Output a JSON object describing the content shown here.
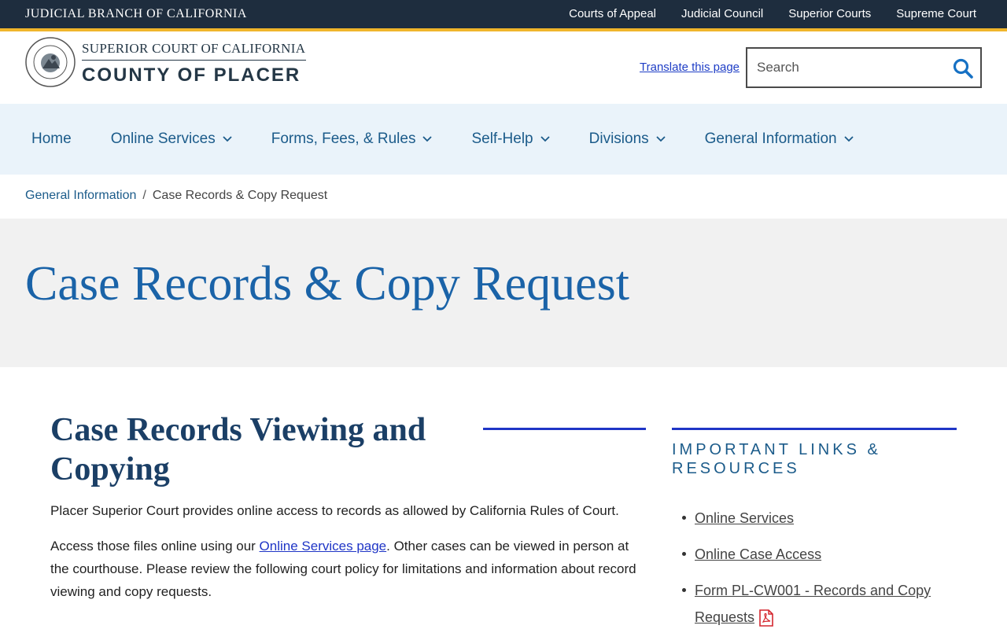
{
  "topbar": {
    "brand": "JUDICIAL BRANCH OF CALIFORNIA",
    "links": [
      "Courts of Appeal",
      "Judicial Council",
      "Superior Courts",
      "Supreme Court"
    ]
  },
  "header": {
    "logo_top": "SUPERIOR COURT OF CALIFORNIA",
    "logo_bottom": "COUNTY OF PLACER",
    "translate": "Translate this page",
    "search_placeholder": "Search"
  },
  "nav": {
    "items": [
      {
        "label": "Home"
      },
      {
        "label": "Online Services"
      },
      {
        "label": "Forms, Fees, & Rules"
      },
      {
        "label": "Self-Help"
      },
      {
        "label": "Divisions"
      },
      {
        "label": "General Information"
      }
    ]
  },
  "breadcrumb": {
    "parent": "General Information",
    "separator": "/",
    "current": "Case Records & Copy Request"
  },
  "hero": {
    "title": "Case Records & Copy Request"
  },
  "main": {
    "heading": "Case Records Viewing and Copying",
    "para1": "Placer Superior Court provides online access to records as allowed by California Rules of Court.",
    "para2_before": "Access those files online using our ",
    "para2_link": "Online Services page",
    "para2_after": ". Other cases can be viewed in person at the courthouse. Please review the following court policy for limitations and information about record viewing and copy requests."
  },
  "sidebar": {
    "title": "IMPORTANT LINKS & RESOURCES",
    "links": [
      {
        "label": "Online Services"
      },
      {
        "label": "Online Case Access"
      },
      {
        "label": "Form PL-CW001 - Records and Copy Requests"
      }
    ]
  },
  "colors": {
    "topbar": "#1e2d3e",
    "accent_gold": "#f0b52b",
    "nav_bg": "#eaf3fa",
    "link_blue": "#1b5b8a",
    "rule_blue": "#1f35c6",
    "hero_bg": "#f1f1f1"
  },
  "icons": [
    "seal-icon",
    "search-icon",
    "chevron-down-icon",
    "pdf-icon"
  ]
}
